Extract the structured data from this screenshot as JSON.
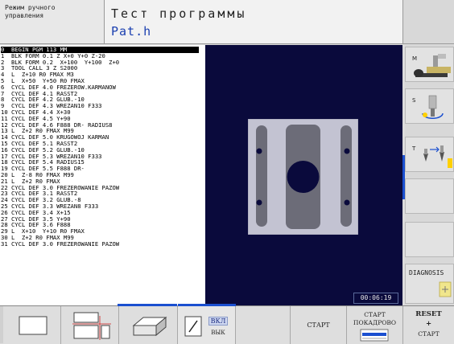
{
  "header": {
    "mode_line1": "Режим ручного",
    "mode_line2": "управления",
    "title": "Тест программы",
    "filename": "Pat.h"
  },
  "program": [
    "0  BEGIN PGM 113 MM",
    "1  BLK FORM 0.1 Z X+0 Y+0 Z-20",
    "2  BLK FORM 0.2  X+100  Y+100  Z+0",
    "3  TOOL CALL 3 Z S2000",
    "4  L  Z+10 R0 FMAX M3",
    "5  L  X+50  Y+50 R0 FMAX",
    "6  CYCL DEF 4.0 FREZEROW.KARMANOW",
    "7  CYCL DEF 4.1 RASST2",
    "8  CYCL DEF 4.2 GLUB.-10",
    "9  CYCL DEF 4.3 WREZAN10 F333",
    "10 CYCL DEF 4.4 X+30",
    "11 CYCL DEF 4.5 Y+90",
    "12 CYCL DEF 4.6 F888 DR- RADIUS8",
    "13 L  Z+2 R0 FMAX M99",
    "14 CYCL DEF 5.0 KRUGOWOJ KARMAN",
    "15 CYCL DEF 5.1 RASST2",
    "16 CYCL DEF 5.2 GLUB.-10",
    "17 CYCL DEF 5.3 WREZAN10 F333",
    "18 CYCL DEF 5.4 RADIUS15",
    "19 CYCL DEF 5.5 F888 DR-",
    "20 L  Z-8 R0 FMAX M99",
    "21 L  Z+2 R0 FMAX",
    "22 CYCL DEF 3.0 FREZEROWANIE PAZOW",
    "23 CYCL DEF 3.1 RASST2",
    "24 CYCL DEF 3.2 GLUB.-8",
    "25 CYCL DEF 3.3 WREZAN8 F333",
    "26 CYCL DEF 3.4 X+15",
    "27 CYCL DEF 3.5 Y+90",
    "28 CYCL DEF 3.6 F888",
    "29 L  X+10  Y+10 R0 FMAX",
    "30 L  Z+2 R0 FMAX M99",
    "31 CYCL DEF 3.0 FREZEROWANIE PAZOW"
  ],
  "graphic": {
    "time": "00:06:19"
  },
  "right_softkeys": {
    "m_label": "M",
    "s_label": "S",
    "t_label": "T",
    "diagnosis": "DIAGNOSIS"
  },
  "bottom_softkeys": {
    "on": "ВКЛ",
    "off": "ВЫК",
    "start": "СТАРТ",
    "start_single_1": "СТАРТ",
    "start_single_2": "ПОКАДРОВО",
    "reset": "RESET",
    "plus": "+",
    "reset_start": "СТАРТ"
  },
  "colors": {
    "accent": "#1a4fd0",
    "graphic_bg": "#0a0a3c",
    "part": "#c3c3d2"
  }
}
